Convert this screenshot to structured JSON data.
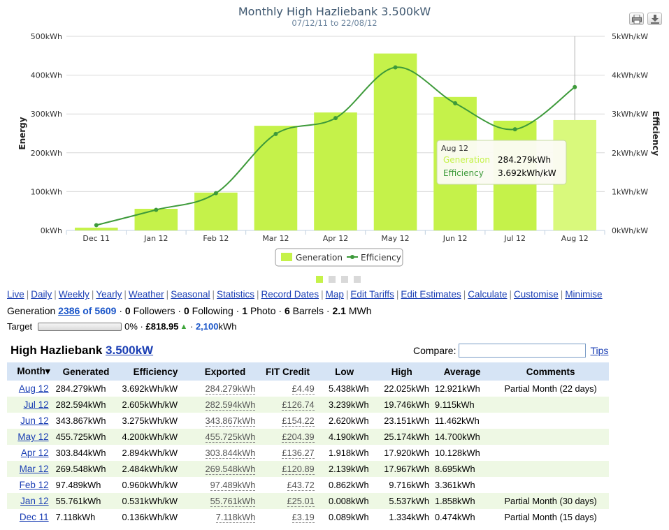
{
  "chart_data": {
    "type": "bar+line",
    "title": "Monthly High Hazliebank 3.500kW",
    "subtitle": "07/12/11 to 22/08/12",
    "categories": [
      "Dec 11",
      "Jan 12",
      "Feb 12",
      "Mar 12",
      "Apr 12",
      "May 12",
      "Jun 12",
      "Jul 12",
      "Aug 12"
    ],
    "series": [
      {
        "name": "Generation",
        "type": "bar",
        "axis": "left",
        "values": [
          7.118,
          55.761,
          97.489,
          269.548,
          303.844,
          455.725,
          343.867,
          282.594,
          284.279
        ]
      },
      {
        "name": "Efficiency",
        "type": "line",
        "axis": "right",
        "values": [
          0.136,
          0.531,
          0.96,
          2.484,
          2.894,
          4.2,
          3.275,
          2.605,
          3.692
        ]
      }
    ],
    "ylabel": "Energy",
    "y2label": "Efficiency",
    "ylim": [
      0,
      500
    ],
    "y2lim": [
      0,
      5
    ],
    "yticks": [
      "0kWh",
      "100kWh",
      "200kWh",
      "300kWh",
      "400kWh",
      "500kWh"
    ],
    "y2ticks": [
      "0kWh/kW",
      "1kWh/kW",
      "2kWh/kW",
      "3kWh/kW",
      "4kWh/kW",
      "5kWh/kW"
    ],
    "legend_position": "bottom-center",
    "colors": {
      "bar": "#c5f24a",
      "bar_highlight": "#d9f97c",
      "line": "#3d9a3a",
      "grid": "#d8d8d8"
    },
    "tooltip": {
      "header": "Aug 12",
      "gen_label": "Generation",
      "gen_value": "284.279kWh",
      "eff_label": "Efficiency",
      "eff_value": "3.692kWh/kW"
    }
  },
  "chart_buttons": {
    "print": "print-icon",
    "export": "download-icon"
  },
  "nav": [
    "Live",
    "Daily",
    "Weekly",
    "Yearly",
    "Weather",
    "Seasonal",
    "Statistics",
    "Record Dates",
    "Map",
    "Edit Tariffs",
    "Edit Estimates",
    "Calculate",
    "Customise",
    "Minimise"
  ],
  "generation": {
    "label": "Generation",
    "rank": "2386",
    "of": "of 5609",
    "followers": "0",
    "followers_label": "Followers",
    "following": "0",
    "following_label": "Following",
    "photos": "1",
    "photos_label": "Photo",
    "barrels": "6",
    "barrels_label": "Barrels",
    "mwh": "2.1",
    "mwh_unit": "MWh"
  },
  "target": {
    "label": "Target",
    "percent": "0%",
    "savings": "£818.95",
    "kwh": "2,100",
    "kwh_unit": "kWh"
  },
  "site": {
    "name": "High Hazliebank",
    "size": "3.500kW"
  },
  "compare": {
    "label": "Compare:",
    "value": "",
    "tips": "Tips"
  },
  "table": {
    "headers": [
      "Month▾",
      "Generated",
      "Efficiency",
      "Exported",
      "FIT Credit",
      "Low",
      "High",
      "Average",
      "Comments"
    ],
    "rows": [
      [
        "Aug 12",
        "284.279kWh",
        "3.692kWh/kW",
        "284.279kWh",
        "£4.49",
        "5.438kWh",
        "22.025kWh",
        "12.921kWh",
        "Partial Month (22 days)"
      ],
      [
        "Jul 12",
        "282.594kWh",
        "2.605kWh/kW",
        "282.594kWh",
        "£126.74",
        "3.239kWh",
        "19.746kWh",
        "9.115kWh",
        ""
      ],
      [
        "Jun 12",
        "343.867kWh",
        "3.275kWh/kW",
        "343.867kWh",
        "£154.22",
        "2.620kWh",
        "23.151kWh",
        "11.462kWh",
        ""
      ],
      [
        "May 12",
        "455.725kWh",
        "4.200kWh/kW",
        "455.725kWh",
        "£204.39",
        "4.190kWh",
        "25.174kWh",
        "14.700kWh",
        ""
      ],
      [
        "Apr 12",
        "303.844kWh",
        "2.894kWh/kW",
        "303.844kWh",
        "£136.27",
        "1.918kWh",
        "17.920kWh",
        "10.128kWh",
        ""
      ],
      [
        "Mar 12",
        "269.548kWh",
        "2.484kWh/kW",
        "269.548kWh",
        "£120.89",
        "2.139kWh",
        "17.967kWh",
        "8.695kWh",
        ""
      ],
      [
        "Feb 12",
        "97.489kWh",
        "0.960kWh/kW",
        "97.489kWh",
        "£43.72",
        "0.862kWh",
        "9.716kWh",
        "3.361kWh",
        ""
      ],
      [
        "Jan 12",
        "55.761kWh",
        "0.531kWh/kW",
        "55.761kWh",
        "£25.01",
        "0.008kWh",
        "5.537kWh",
        "1.858kWh",
        "Partial Month (30 days)"
      ],
      [
        "Dec 11",
        "7.118kWh",
        "0.136kWh/kW",
        "7.118kWh",
        "£3.19",
        "0.089kWh",
        "1.334kWh",
        "0.474kWh",
        "Partial Month (15 days)"
      ]
    ]
  }
}
